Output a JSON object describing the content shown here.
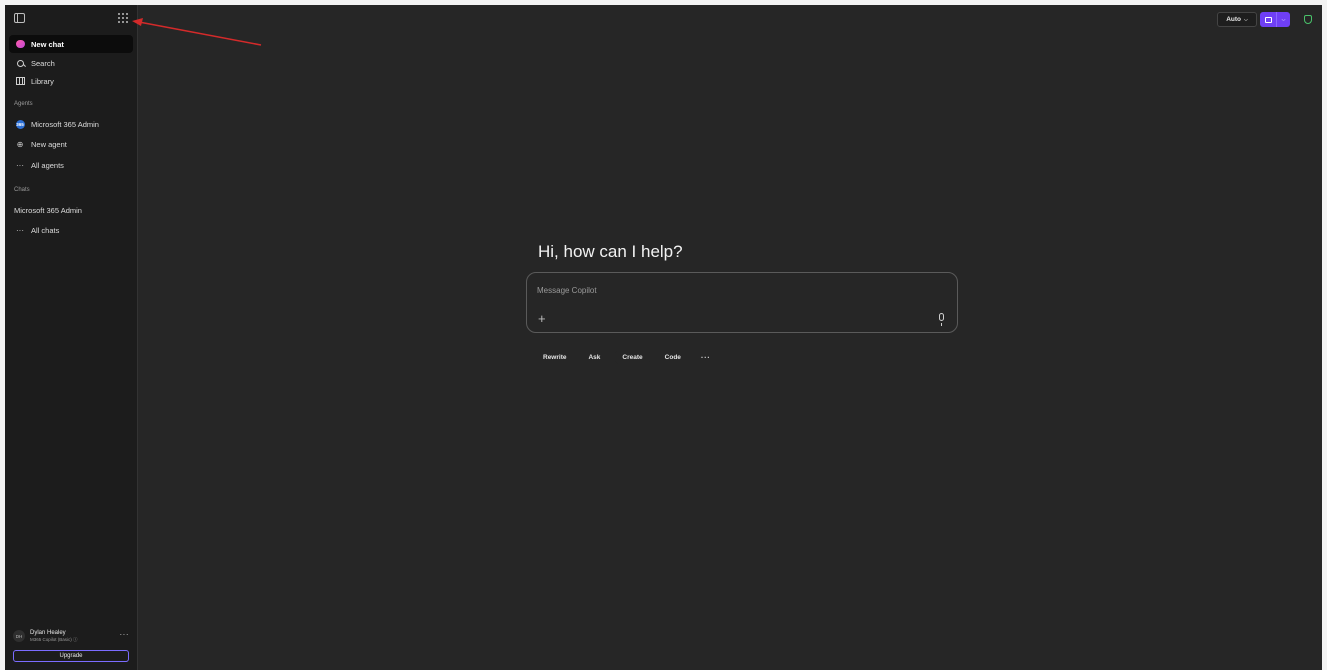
{
  "sidebar": {
    "new_chat": "New chat",
    "search": "Search",
    "library": "Library",
    "agents_label": "Agents",
    "agents": [
      {
        "label": "Microsoft 365 Admin",
        "badge": "365"
      },
      {
        "label": "New agent"
      },
      {
        "label": "All agents"
      }
    ],
    "chats_label": "Chats",
    "chats": [
      {
        "label": "Microsoft 365 Admin"
      },
      {
        "label": "All chats"
      }
    ],
    "user": {
      "initials": "DH",
      "name": "Dylan Healey",
      "plan": "M365 Copilot (Basic)"
    },
    "upgrade": "Upgrade"
  },
  "header": {
    "model_selector": "Auto"
  },
  "main": {
    "greeting": "Hi, how can I help?",
    "composer_placeholder": "Message Copilot",
    "chips": [
      "Rewrite",
      "Ask",
      "Create",
      "Code"
    ]
  },
  "colors": {
    "accent": "#6f3ff5",
    "background": "#262626",
    "sidebar": "#1c1c1c",
    "annotation_arrow": "#d42a2a"
  }
}
